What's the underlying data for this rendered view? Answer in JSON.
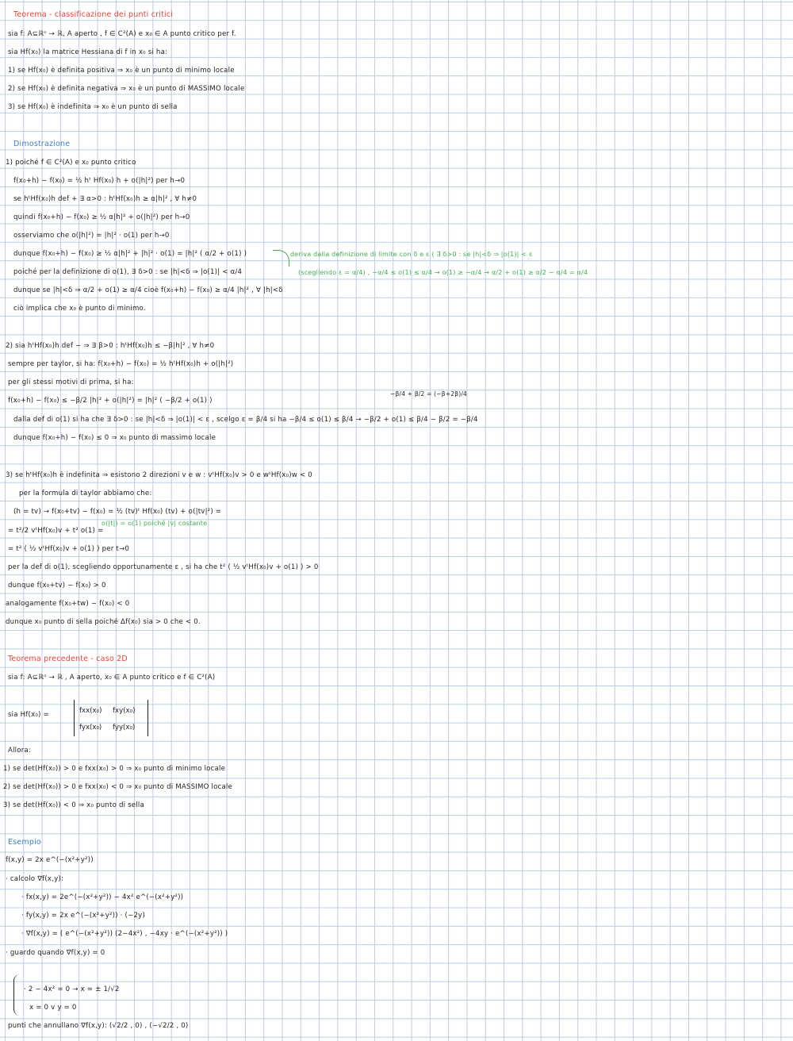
{
  "section1": {
    "title": "Teorema - classificazione dei punti critici",
    "lines": [
      "sia f: A⊆ℝⁿ → ℝ, A aperto , f ∈ C²(A) e x₀ ∈ A punto critico per f.",
      "sia Hf(x₀) la matrice Hessiana di f in x₀ si ha:",
      "1)  se Hf(x₀) è definita positiva ⇒ x₀ è un punto di minimo locale",
      "2)  se Hf(x₀) è definita negativa ⇒ x₀ è un punto di MASSIMO locale",
      "3)  se Hf(x₀) è indefinita ⇒ x₀ è un punto di sella"
    ]
  },
  "proof": {
    "title": "Dimostrazione",
    "part1": [
      "1)  poiché f ∈ C²(A) e x₀ punto critico",
      "f(x₀+h) − f(x₀) = ½ hᵗ Hf(x₀) h + o(|h|²)   per h→0",
      "se hᵗHf(x₀)h def + ∃ α>0 : hᵗHf(x₀)h ≥ α|h|² , ∀ h≠0",
      "quindi  f(x₀+h) − f(x₀) ≥ ½ α|h|² + o(|h|²)   per h→0",
      "osserviamo che  o(|h|²) = |h|² · o(1)   per h→0",
      "dunque  f(x₀+h) − f(x₀) ≥ ½ α|h|² + |h|² · o(1) = |h|² ( α/2 + o(1) )",
      "poiché per la definizione di o(1), ∃ δ>0 : se |h|<δ ⇒ |o(1)| < α/4",
      "dunque  se |h|<δ ⇒ α/2 + o(1) ≥ α/4   cioè  f(x₀+h) − f(x₀) ≥ α/4 |h|² ,  ∀ |h|<δ",
      "ciò implica che x₀ è punto di minimo."
    ],
    "green_note_1": "deriva dalla definizione di limite con δ e ε  ( ∃ δ>0 : se |h|<δ ⇒ |o(1)| < ε",
    "green_note_2": "(scegliendo ε = α/4)  ,  −α/4 ≤ o(1) ≤ α/4  →  o(1) ≥ −α/4  →  α/2 + o(1) ≥ α/2 − α/4 = α/4",
    "part2": [
      "2)  sia hᵗHf(x₀)h def − ⇒ ∃ β>0 : hᵗHf(x₀)h ≤ −β|h|² ,  ∀ h≠0",
      "sempre per taylor, si ha:  f(x₀+h) − f(x₀) = ½ hᵗHf(x₀)h + o(|h|²)",
      "per gli stessi motivi di prima, si ha:",
      "f(x₀+h) − f(x₀) ≤ −β/2 |h|² + o(|h|²) = |h|² ( −β/2 + o(1) )",
      "dalla def di o(1) si ha che ∃ δ>0 : se |h|<δ ⇒ |o(1)| < ε ,  scelgo ε = β/4  si ha  −β/4 ≤ o(1) ≤ β/4  →  −β/2 + o(1) ≤ β/4 − β/2 = −β/4",
      "dunque  f(x₀+h) − f(x₀) ≤ 0  ⇒  x₀ punto di massimo locale"
    ],
    "side_calc": "−β/4 + β/2 = (−β+2β)/4",
    "part3": [
      "3)  se hᵗHf(x₀)h è indefinita ⇒ esistono 2 direzioni v e w :  vᵗHf(x₀)v > 0  e  wᵗHf(x₀)w < 0",
      "per la formula di taylor abbiamo che:",
      "(h = tv) → f(x₀+tv) − f(x₀) = ½ (tv)ᵗ Hf(x₀) (tv) + o(|tv|²) =",
      "= t²/2 vᵗHf(x₀)v + t² o(1) =",
      "= t² ( ½ vᵗHf(x₀)v + o(1) )   per t→0",
      "per la def di o(1), scegliendo opportunamente ε ,  si ha che  t² ( ½ vᵗHf(x₀)v + o(1) ) > 0",
      "dunque  f(x₀+tv) − f(x₀) > 0",
      "analogamente  f(x₀+tw) − f(x₀) < 0",
      "dunque x₀ punto di sella poiché  Δf(x₀) sia > 0 che < 0."
    ],
    "green_note_3": "o(|t|) = o(1) poiché |v| costante"
  },
  "section2": {
    "title": "Teorema precedente - caso 2D",
    "line1": "sia f: A⊆ℝⁿ → ℝ , A aperto, x₀ ∈ A punto critico  e  f ∈ C²(A)",
    "hessian_label": "sia  Hf(x₀) =",
    "matrix": [
      "fxx(x₀)",
      "fxy(x₀)",
      "fyx(x₀)",
      "fyy(x₀)"
    ],
    "allora": "Allora:",
    "cases": [
      "1)  se det(Hf(x₀)) > 0  e  fxx(x₀) > 0  ⇒  x₀ punto di minimo locale",
      "2)  se det(Hf(x₀)) > 0  e  fxx(x₀) < 0  ⇒  x₀ punto di MASSIMO locale",
      "3)  se det(Hf(x₀)) < 0  ⇒  x₀ punto di sella"
    ]
  },
  "example": {
    "title": "Esempio",
    "function": "f(x,y) = 2x e^(−(x²+y²))",
    "lines": [
      "· calcolo ∇f(x,y):",
      "· fx(x,y) = 2e^(−(x²+y²)) − 4x² e^(−(x²+y²))",
      "· fy(x,y) = 2x e^(−(x²+y²)) · (−2y)",
      "· ∇f(x,y) = ( e^(−(x²+y²)) (2−4x²) ,  −4xy · e^(−(x²+y²)) )",
      "· guardo quando ∇f(x,y) = 0"
    ],
    "system": [
      "· 2 − 4x² = 0  →  x = ± 1/√2",
      "x = 0   v   y = 0"
    ],
    "conclusion": "punti che annullano ∇f(x,y):  (√2/2 , 0) ,  (−√2/2 , 0)"
  }
}
